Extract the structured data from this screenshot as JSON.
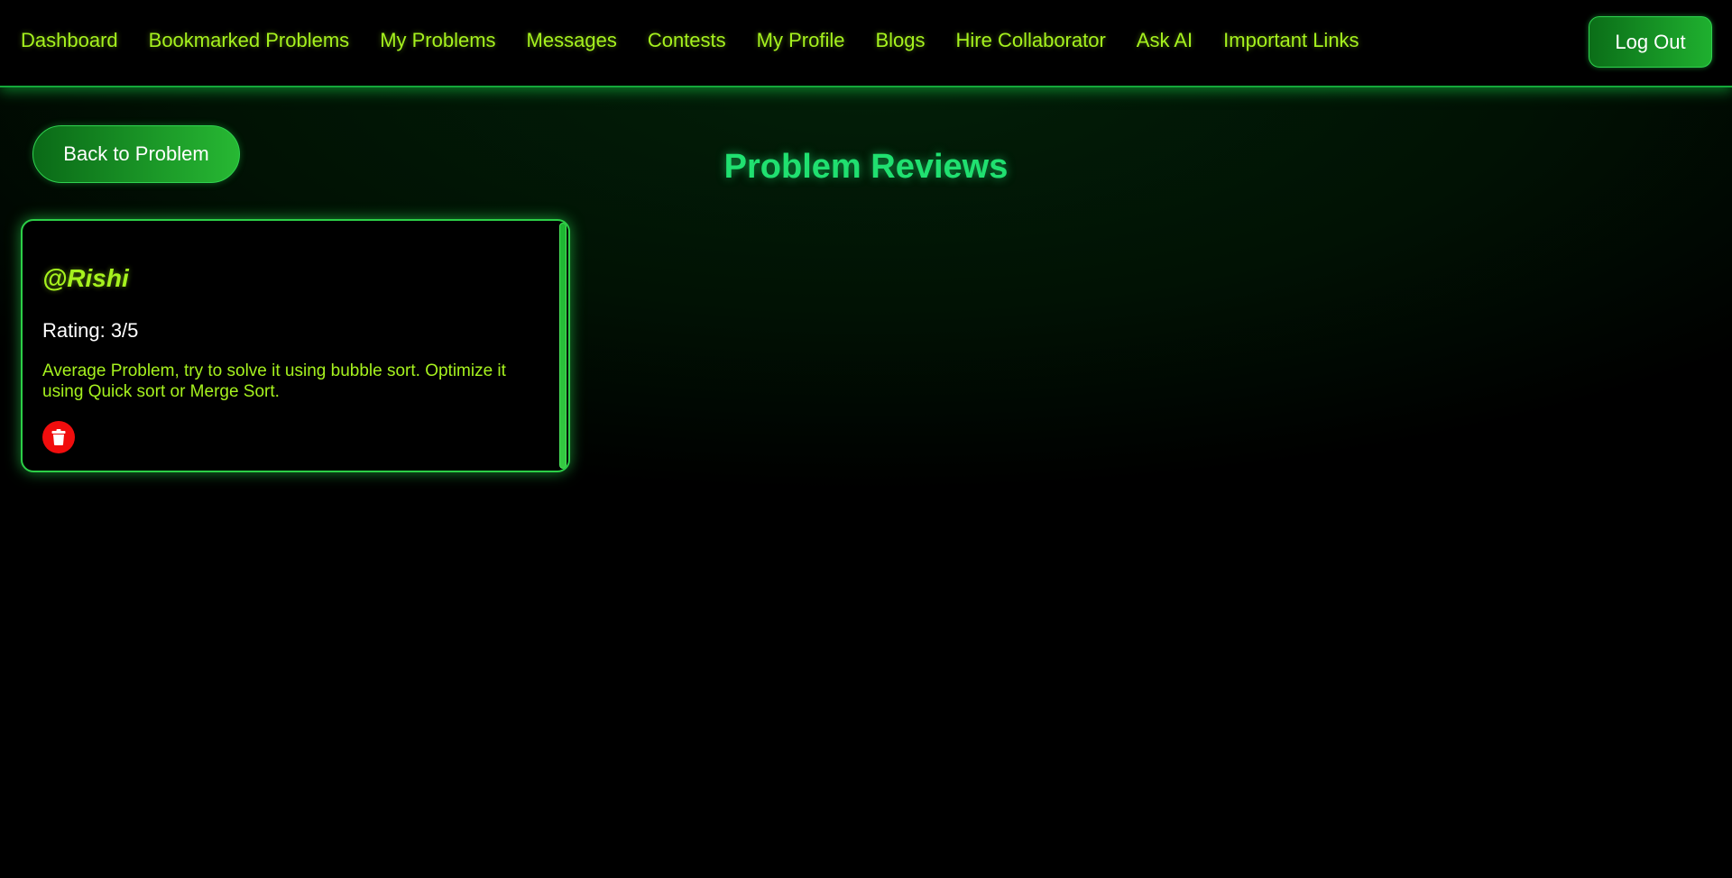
{
  "nav": {
    "links": [
      {
        "label": "Dashboard"
      },
      {
        "label": "Bookmarked Problems"
      },
      {
        "label": "My Problems"
      },
      {
        "label": "Messages"
      },
      {
        "label": "Contests"
      },
      {
        "label": "My Profile"
      },
      {
        "label": "Blogs"
      },
      {
        "label": "Hire Collaborator"
      },
      {
        "label": "Ask AI"
      },
      {
        "label": "Important Links"
      }
    ],
    "logout_label": "Log Out"
  },
  "back_button_label": "Back to Problem",
  "page_title": "Problem Reviews",
  "reviews": [
    {
      "user": "@Rishi",
      "rating": "Rating: 3/5",
      "text": "Average Problem, try to solve it using bubble sort. Optimize it using Quick sort or Merge Sort.",
      "delete_icon": "trash-icon"
    }
  ],
  "colors": {
    "accent_lime": "#a6f21e",
    "title_green": "#20e070",
    "button_green": "#1fb02f",
    "delete_red": "#f10d0d"
  }
}
